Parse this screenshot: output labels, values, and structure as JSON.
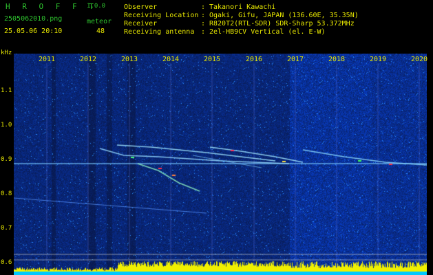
{
  "app": {
    "brand": "H R O F F T",
    "version": "1.0.0"
  },
  "file": {
    "name": "2505062010.png",
    "timestamp": "25.05.06 20:10"
  },
  "meteor": {
    "label": "meteor",
    "count": "48"
  },
  "info": [
    {
      "label": "Observer",
      "value": "Takanori Kawachi"
    },
    {
      "label": "Receiving Location",
      "value": "Ogaki, Gifu, JAPAN (136.60E, 35.35N)"
    },
    {
      "label": "Receiver",
      "value": "R820T2(RTL-SDR) SDR-Sharp 53.372MHz"
    },
    {
      "label": "Receiving antenna",
      "value": "2el-HB9CV Vertical (el. E-W)"
    }
  ],
  "separator": ":",
  "y_axis": {
    "unit": "kHz",
    "ticks": [
      "1.1",
      "1.0",
      "0.9",
      "0.8",
      "0.7",
      "0.6"
    ],
    "tick_values": [
      1.1,
      1.0,
      0.9,
      0.8,
      0.7,
      0.6
    ]
  },
  "x_axis": {
    "ticks": [
      "2011",
      "2012",
      "2013",
      "2014",
      "2015",
      "2016",
      "2017",
      "2018",
      "2019",
      "2020"
    ]
  },
  "colors": {
    "background": "#000000",
    "brand": "#2ec22e",
    "text": "#e8e800",
    "label_green": "#2ec22e",
    "spectrum_base": "#0a1a8c",
    "bottom_level": "#f0f000",
    "bottom_base": "#00c8ff"
  }
}
